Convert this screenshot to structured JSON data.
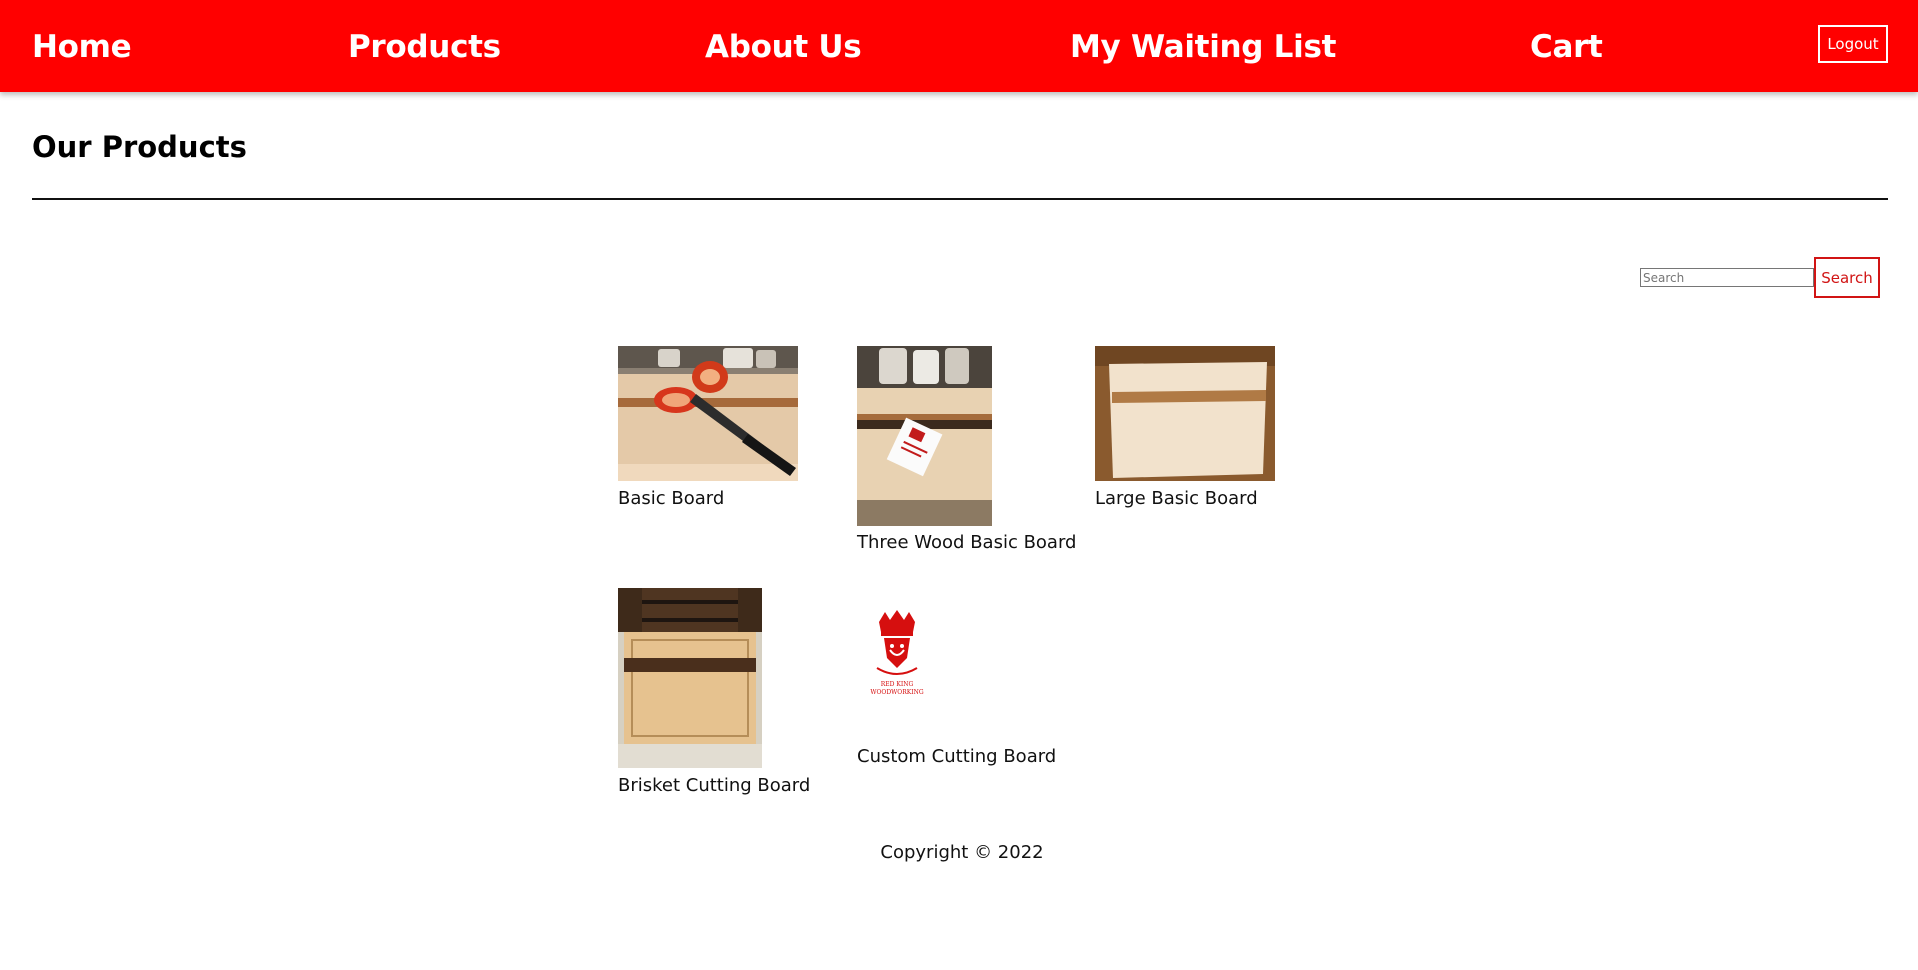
{
  "nav": {
    "links": [
      "Home",
      "Products",
      "About Us",
      "My Waiting List",
      "Cart"
    ],
    "logout_label": "Logout"
  },
  "page": {
    "title": "Our Products"
  },
  "search": {
    "placeholder": "Search",
    "button_label": "Search"
  },
  "products": [
    {
      "name": "Basic Board",
      "image": "cutting-board-with-red-pepper-and-knife"
    },
    {
      "name": "Three Wood Basic Board",
      "image": "three-wood-board-with-business-card"
    },
    {
      "name": "Large Basic Board",
      "image": "large-maple-board-on-table"
    },
    {
      "name": "Brisket Cutting Board",
      "image": "brisket-board-with-juice-groove"
    },
    {
      "name": "Custom Cutting Board",
      "image": "red-king-woodworking-logo"
    }
  ],
  "logo_text": {
    "line1": "RED KING",
    "line2": "WOODWORKING"
  },
  "footer": {
    "copyright": "Copyright © 2022"
  },
  "colors": {
    "nav_background": "#ff0000",
    "accent": "#d11414",
    "text": "#111111"
  }
}
